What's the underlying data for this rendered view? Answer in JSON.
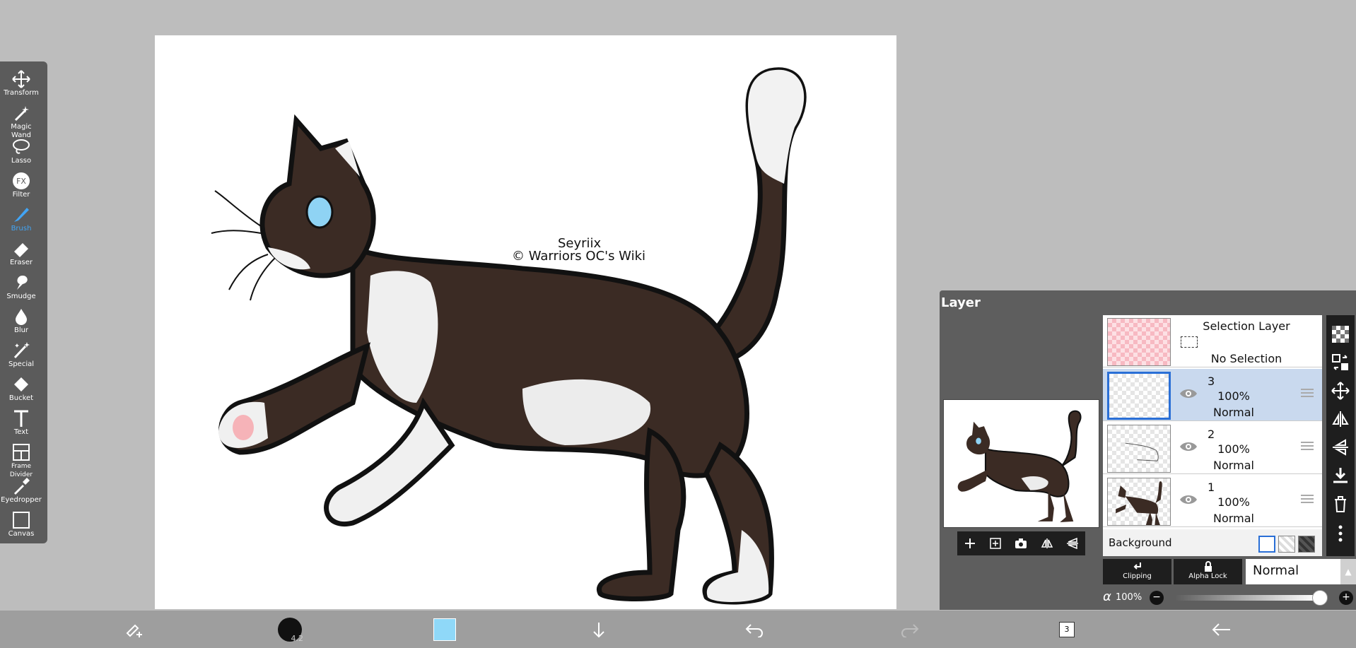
{
  "toolbar": {
    "tools": [
      {
        "label": "Transform",
        "icon": "transform-icon"
      },
      {
        "label": "Magic Wand",
        "icon": "magic-wand-icon"
      },
      {
        "label": "Lasso",
        "icon": "lasso-icon"
      },
      {
        "label": "Filter",
        "icon": "filter-icon"
      },
      {
        "label": "Brush",
        "icon": "brush-icon",
        "active": true
      },
      {
        "label": "Eraser",
        "icon": "eraser-icon"
      },
      {
        "label": "Smudge",
        "icon": "smudge-icon"
      },
      {
        "label": "Blur",
        "icon": "blur-icon"
      },
      {
        "label": "Special",
        "icon": "special-icon"
      },
      {
        "label": "Bucket",
        "icon": "bucket-icon"
      },
      {
        "label": "Text",
        "icon": "text-icon"
      },
      {
        "label": "Frame Divider",
        "icon": "frame-divider-icon"
      },
      {
        "label": "Eyedropper",
        "icon": "eyedropper-icon"
      },
      {
        "label": "Canvas",
        "icon": "canvas-icon"
      }
    ],
    "active_color": "#42a5f5"
  },
  "canvas": {
    "watermark_line1": "Seyriix",
    "watermark_line2": "© Warriors OC's Wiki",
    "fur_color": "#3b2b24",
    "eye_color": "#8fd3f4"
  },
  "layer_panel": {
    "title": "Layer",
    "selection_layer": {
      "title": "Selection Layer",
      "status": "No Selection"
    },
    "layers": [
      {
        "number": "3",
        "opacity": "100%",
        "mode": "Normal",
        "selected": true
      },
      {
        "number": "2",
        "opacity": "100%",
        "mode": "Normal",
        "selected": false
      },
      {
        "number": "1",
        "opacity": "100%",
        "mode": "Normal",
        "selected": false
      }
    ],
    "background_label": "Background",
    "clipping_label": "Clipping",
    "alpha_lock_label": "Alpha Lock",
    "blend_mode": "Normal",
    "alpha_symbol": "α",
    "alpha_value": "100%",
    "alpha_fraction": 1.0,
    "minus": "−",
    "plus": "+"
  },
  "bottom_bar": {
    "brush_size": "4.2",
    "current_color": "#8fd8f8",
    "layer_count": "3"
  }
}
